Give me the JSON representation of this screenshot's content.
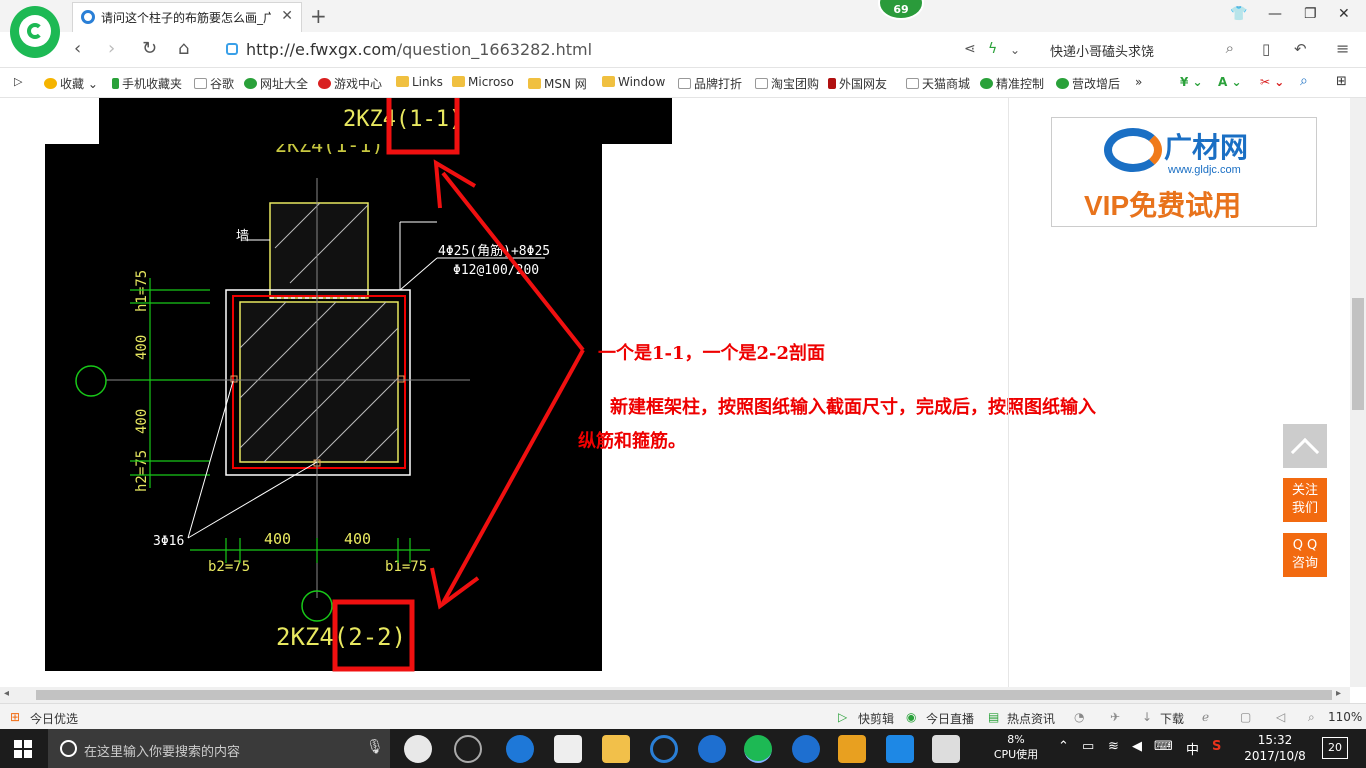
{
  "tab": {
    "title": "请问这个柱子的布筋要怎么画_广",
    "close": "✕",
    "new": "+"
  },
  "badge": "69",
  "window": {
    "min": "—",
    "max": "❐",
    "close": "✕",
    "shirt": "👕"
  },
  "address": {
    "url_host": "http://e.fwxgx.com",
    "url_path": "/question_1663282.html",
    "search_text": "快递小哥磕头求饶"
  },
  "bookmarks": [
    {
      "label": "收藏",
      "color": "#f5b400"
    },
    {
      "label": "手机收藏夹",
      "color": "#2aa13a"
    },
    {
      "label": "谷歌",
      "color": "#bbbbbb"
    },
    {
      "label": "网址大全",
      "color": "#2aa13a"
    },
    {
      "label": "游戏中心",
      "color": "#d92020"
    },
    {
      "label": "Links",
      "color": "#f0c040"
    },
    {
      "label": "Microso",
      "color": "#f0c040"
    },
    {
      "label": "MSN 网",
      "color": "#f0c040"
    },
    {
      "label": "Window",
      "color": "#f0c040"
    },
    {
      "label": "品牌打折",
      "color": "#bbbbbb"
    },
    {
      "label": "淘宝团购",
      "color": "#bbbbbb"
    },
    {
      "label": "外国网友",
      "color": "#b01010"
    },
    {
      "label": "天猫商城",
      "color": "#bbbbbb"
    },
    {
      "label": "精准控制",
      "color": "#2aa13a"
    },
    {
      "label": "营改增后",
      "color": "#2aa13a"
    }
  ],
  "bookmarks_more": "»",
  "drawing": {
    "top_title": "2KZ4(1-1)",
    "top_title_partial": "2KZ4(1-1)",
    "bottom_title": "2KZ4(2-2)",
    "wall": "墙",
    "rebar1": "4Φ25(角筋)+8Φ25",
    "rebar2": "Φ12@100/200",
    "h1": "h1=75",
    "d400a": "400",
    "d400b": "400",
    "h2": "h2=75",
    "stirrup": "3Φ16",
    "b400a": "400",
    "b400b": "400",
    "b2": "b2=75",
    "b1": "b1=75"
  },
  "answer": {
    "line1": "一个是1-1，一个是2-2剖面",
    "line2": "新建框架柱，按照图纸输入截面尺寸，完成后，按照图纸输入",
    "line3": "纵筋和箍筋。"
  },
  "ad": {
    "brand": "广材网",
    "site": "www.gldjc.com",
    "vip": "VIP免费试用"
  },
  "float": {
    "follow": [
      "关注",
      "我们"
    ],
    "qq": [
      "Q Q",
      "咨询"
    ]
  },
  "status": {
    "left": "今日优选",
    "kuaijianji": "快剪辑",
    "live": "今日直播",
    "hot": "热点资讯",
    "download": "下载",
    "zoom": "110%"
  },
  "taskbar": {
    "search_placeholder": "在这里输入你要搜索的内容",
    "cpu_pct": "8%",
    "cpu_label": "CPU使用",
    "ime": "中",
    "time": "15:32",
    "date": "2017/10/8",
    "notif": "20"
  }
}
